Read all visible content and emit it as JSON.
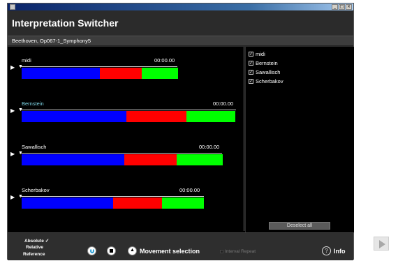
{
  "window": {
    "minimize_glyph": "_",
    "maximize_glyph": "□",
    "close_glyph": "×"
  },
  "header": {
    "title": "Interpretation Switcher",
    "subtitle": "Beethoven, Op067-1_Symphony5"
  },
  "tracks": [
    {
      "name": "midi",
      "time": "00:00.00",
      "name_color": "#ffffff",
      "segments": {
        "blue": 0.5,
        "red": 0.27,
        "green": 0.23
      }
    },
    {
      "name": "Bernstein",
      "time": "00:00.00",
      "name_color": "#7fd7e8",
      "segments": {
        "blue": 0.49,
        "red": 0.28,
        "green": 0.23
      }
    },
    {
      "name": "Sawallisch",
      "time": "00:00.00",
      "name_color": "#ffffff",
      "segments": {
        "blue": 0.51,
        "red": 0.26,
        "green": 0.23
      }
    },
    {
      "name": "Scherbakov",
      "time": "00:00.00",
      "name_color": "#ffffff",
      "segments": {
        "blue": 0.5,
        "red": 0.27,
        "green": 0.23
      }
    }
  ],
  "checklist": [
    {
      "label": "midi",
      "checked": true
    },
    {
      "label": "Bernstein",
      "checked": true
    },
    {
      "label": "Sawallisch",
      "checked": true
    },
    {
      "label": "Scherbakov",
      "checked": true
    }
  ],
  "check_glyph": "✓",
  "deselect_label": "Deselect all",
  "modes": {
    "absolute": "Absolute",
    "relative": "Relative",
    "reference": "Reference",
    "selected_mark": "✓"
  },
  "controls": {
    "movement_label": "Movement selection",
    "interval_label": "Interval Repeat",
    "info_symbol": "?",
    "info_label": "Info",
    "up_glyph": "▲",
    "play_glyph": "▶",
    "handle_glyph": "▼"
  },
  "colors": {
    "blue": "#0000ff",
    "red": "#ff0000",
    "green": "#00ff00",
    "background": "#000000"
  }
}
